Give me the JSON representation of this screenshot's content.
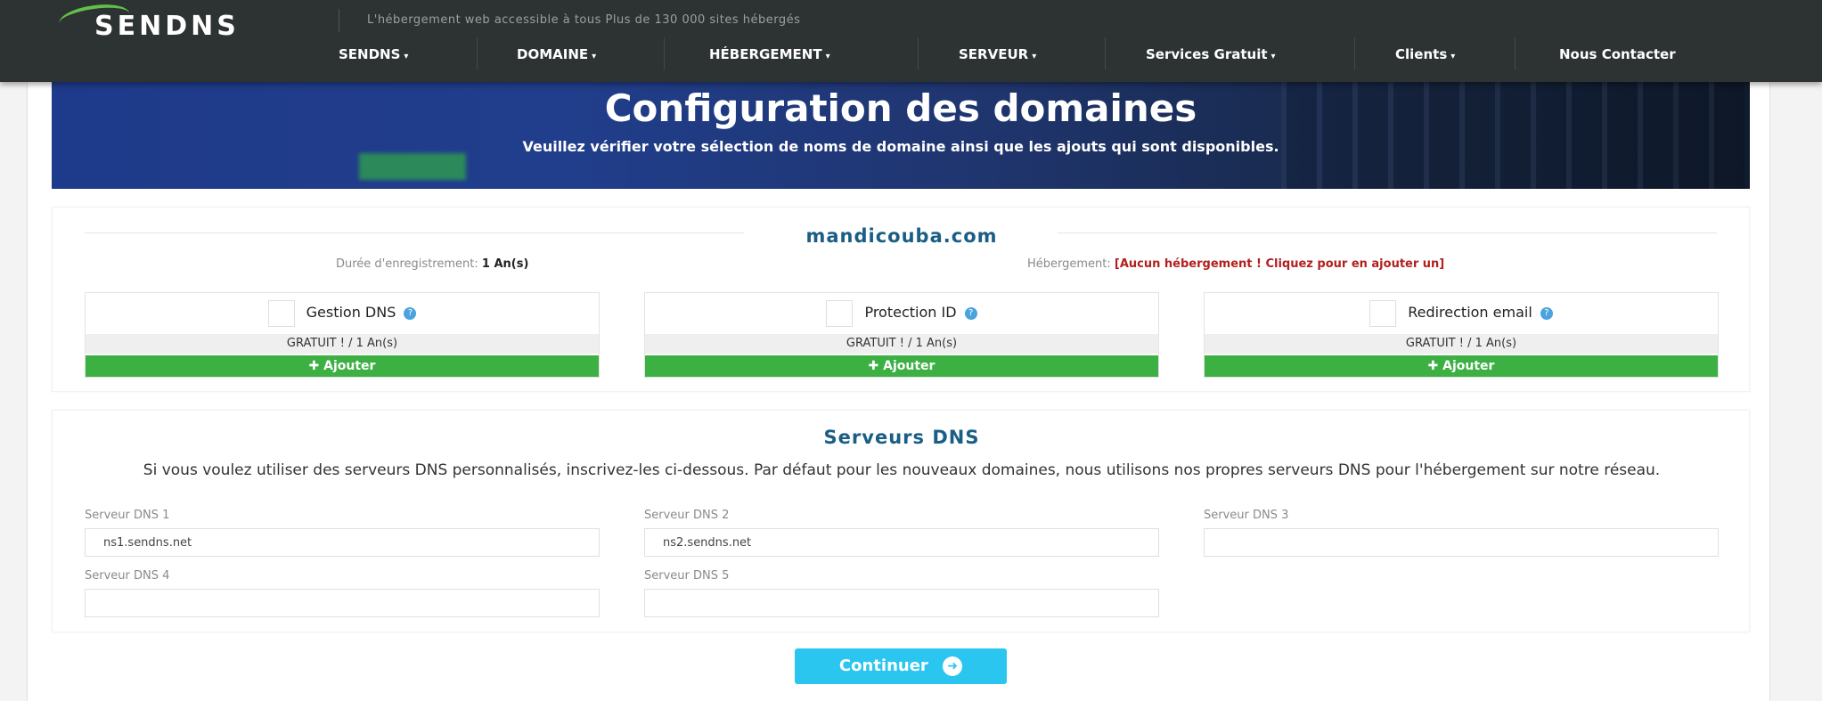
{
  "brand": {
    "logo_text": "SENDNS",
    "tagline": "L'hébergement web accessible à tous Plus de 130 000 sites hébergés"
  },
  "nav": {
    "items": [
      {
        "label": "SENDNS",
        "has_caret": true
      },
      {
        "label": "DOMAINE",
        "has_caret": true
      },
      {
        "label": "HÉBERGEMENT",
        "has_caret": true
      },
      {
        "label": "SERVEUR",
        "has_caret": true
      },
      {
        "label": "Services Gratuit",
        "has_caret": true
      },
      {
        "label": "Clients",
        "has_caret": true
      },
      {
        "label": "Nous Contacter",
        "has_caret": false
      }
    ],
    "caret": "▾"
  },
  "hero": {
    "title": "Configuration des domaines",
    "subtitle": "Veuillez vérifier votre sélection de noms de domaine ainsi que les ajouts qui sont disponibles."
  },
  "domain": {
    "name": "mandicouba.com",
    "duration_label": "Durée d'enregistrement:",
    "duration_value": "1 An(s)",
    "hosting_label": "Hébergement:",
    "hosting_value": "[Aucun hébergement ! Cliquez pour en ajouter un]",
    "addons": [
      {
        "name": "Gestion DNS",
        "price": "GRATUIT ! / 1 An(s)",
        "button": "✚ Ajouter"
      },
      {
        "name": "Protection ID",
        "price": "GRATUIT ! / 1 An(s)",
        "button": "✚ Ajouter"
      },
      {
        "name": "Redirection email",
        "price": "GRATUIT ! / 1 An(s)",
        "button": "✚ Ajouter"
      }
    ]
  },
  "dns": {
    "title": "Serveurs DNS",
    "description": "Si vous voulez utiliser des serveurs DNS personnalisés, inscrivez-les ci-dessous. Par défaut pour les nouveaux domaines, nous utilisons nos propres serveurs DNS pour l'hébergement sur notre réseau.",
    "fields": [
      {
        "label": "Serveur DNS 1",
        "value": "ns1.sendns.net"
      },
      {
        "label": "Serveur DNS 2",
        "value": "ns2.sendns.net"
      },
      {
        "label": "Serveur DNS 3",
        "value": ""
      },
      {
        "label": "Serveur DNS 4",
        "value": ""
      },
      {
        "label": "Serveur DNS 5",
        "value": ""
      }
    ]
  },
  "continue_button": "Continuer",
  "colors": {
    "topbar": "#2d3232",
    "accent_blue": "#1a5e85",
    "green": "#3cb043",
    "cyan": "#2ac6f0",
    "alert_red": "#b21f1f"
  }
}
